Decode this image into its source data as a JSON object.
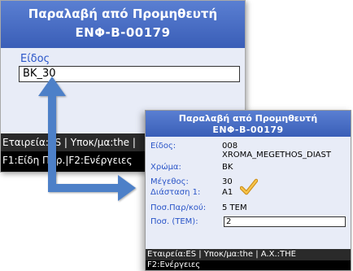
{
  "back_screen": {
    "title": "Παραλαβή από Προμηθευτή",
    "code": "ΕΝΦ-Β-00179",
    "item_label": "Είδος",
    "item_value": "BK_30",
    "status_bar": "Εταιρεία:ES | Υποκ/μα:the |",
    "fkeys": "F1:Είδη Παρ.|F2:Ενέργειες"
  },
  "front_screen": {
    "title": "Παραλαβή από Προμηθευτή",
    "code": "ΕΝΦ-Β-00179",
    "fields": {
      "item_label": "Είδος:",
      "item_code": "008",
      "item_desc": "XROMA_MEGETHOS_DIAST",
      "color_label": "Χρώμα:",
      "color_value": "BK",
      "size_label": "Μέγεθος:",
      "size_value": "30",
      "dim_label": "Διάσταση 1:",
      "dim_value": "A1",
      "qty_per_pack_label": "Ποσ.Παρ/κού:",
      "qty_per_pack_value": "5 TEM",
      "qty_label": "Ποσ. (TEM):",
      "qty_value": "2"
    },
    "status_bar": "Εταιρεία:ES | Υποκ/μα:the | A.X.:THE",
    "fkeys": "F2:Ενέργειες"
  },
  "colors": {
    "header_blue": "#3a5eb7",
    "label_blue": "#2a55c8",
    "arrow_blue": "#4d80c8",
    "checkmark": "#f2b632"
  },
  "icons": [
    "arrow-connector-icon",
    "checkmark-icon"
  ]
}
